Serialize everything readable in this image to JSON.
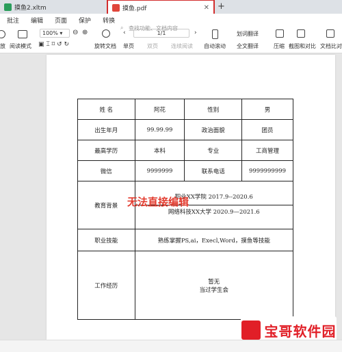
{
  "tabs": [
    {
      "label": "摸鱼2.xltm",
      "icon_color": "#2a9d5b"
    },
    {
      "label": "摸鱼.pdf",
      "icon_color": "#e0463b",
      "active": true
    }
  ],
  "menu": [
    "批注",
    "编辑",
    "页面",
    "保护",
    "转换"
  ],
  "toolbar": {
    "zoom": "100%",
    "page": "1/1",
    "search_placeholder": "查找功能、文档内容",
    "items": {
      "fang": "放",
      "read_mode": "阅读模式",
      "rotate": "旋转文档",
      "single": "单页",
      "double": "双页",
      "continuous": "连续阅读",
      "auto_scroll": "自动滚动",
      "translate": "划词翻译",
      "full_translate": "全文翻译",
      "compress": "压缩",
      "screenshot": "截图和对比",
      "compare": "文档比对"
    }
  },
  "resume": {
    "name_label": "姓 名",
    "name_value": "阿花",
    "gender_label": "性别",
    "gender_value": "男",
    "birth_label": "出生年月",
    "birth_value": "99.99.99",
    "politics_label": "政治面貌",
    "politics_value": "团员",
    "edu_label": "最高学历",
    "edu_value": "本科",
    "major_label": "专业",
    "major_value": "工商管理",
    "wechat_label": "微信",
    "wechat_value": "9999999",
    "phone_label": "联系电话",
    "phone_value": "9999999999",
    "background_label": "教育背景",
    "background_lines": [
      "职业XX学院     2017.9--2020.6",
      "网络科技XX大学   2020.9—2021.6"
    ],
    "skills_label": "职业技能",
    "skills_value": "熟练掌握PS,ai，Execl,Word，摸鱼等技能",
    "work_label": "工作经历",
    "work_lines": [
      "暂无",
      "当过学生会"
    ]
  },
  "overlay_text": "无法直接编辑",
  "brand_text": "宝哥软件园",
  "colors": {
    "accent_red": "#d22c2c",
    "overlay_red": "#e23b2e",
    "brand_red": "#e11f27"
  }
}
